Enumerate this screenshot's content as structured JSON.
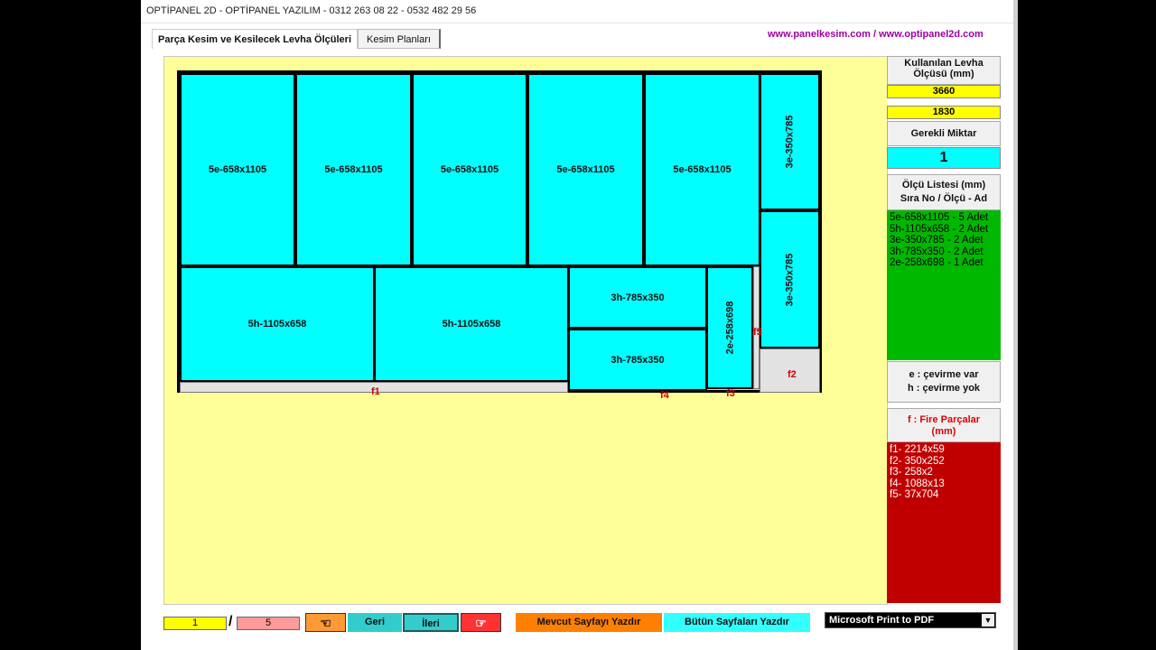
{
  "window": {
    "title": "OPTİPANEL 2D - OPTİPANEL YAZILIM - 0312 263 08 22 - 0532 482 29 56"
  },
  "tabs": [
    {
      "label": "Parça Kesim ve Kesilecek Levha Ölçüleri"
    },
    {
      "label": "Kesim Planları"
    }
  ],
  "weblink": "www.panelkesim.com / www.optipanel2d.com",
  "pieces": [
    "5e-658x1105",
    "5e-658x1105",
    "5e-658x1105",
    "5e-658x1105",
    "5e-658x1105",
    "3e-350x785",
    "3e-350x785",
    "5h-1105x658",
    "5h-1105x658",
    "3h-785x350",
    "3h-785x350",
    "2e-258x698"
  ],
  "fire_labels": [
    "f1",
    "f2",
    "f3",
    "f4",
    "f5"
  ],
  "sidebar": {
    "sheet_size_label": "Kullanılan Levha Ölçüsü (mm)",
    "sheet_length": "3660",
    "sheet_width": "1830",
    "required_qty_label": "Gerekli Miktar",
    "required_qty": "1",
    "size_list_label_1": "Ölçü Listesi (mm)",
    "size_list_label_2": "Sıra No / Ölçü - Ad",
    "size_list": [
      "5e-658x1105 - 5 Adet",
      "5h-1105x658 - 2 Adet",
      "3e-350x785 - 2 Adet",
      "3h-785x350 - 2 Adet",
      "2e-258x698 - 1 Adet"
    ],
    "legend_e": "e : çevirme var",
    "legend_h": "h : çevirme yok",
    "fire_header_1": "f : Fire Parçalar",
    "fire_header_2": "(mm)",
    "fire_list": [
      "f1- 2214x59",
      "f2- 350x252",
      "f3- 258x2",
      "f4- 1088x13",
      "f5- 37x704"
    ]
  },
  "footer": {
    "page_current": "1",
    "page_sep": "/",
    "page_total": "5",
    "back_label": "Geri",
    "next_label": "İleri",
    "print_current_label": "Mevcut Sayfayı Yazdır",
    "print_all_label": "Bütün Sayfaları Yazdır",
    "printer_selected": "Microsoft Print to PDF"
  },
  "colors": {
    "piece": "#00ffff",
    "canvas": "#ffff99",
    "list_bg": "#00b800",
    "fire_bg": "#c00000",
    "scrap_label": "#d00000"
  }
}
